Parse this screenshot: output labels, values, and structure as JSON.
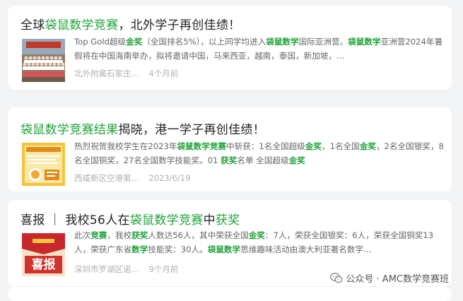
{
  "results": [
    {
      "title_parts": [
        {
          "text": "全球",
          "hl": false
        },
        {
          "text": "袋鼠数学竞赛",
          "hl": true
        },
        {
          "text": "，北外学子再创佳绩！",
          "hl": false
        }
      ],
      "snippet_parts": [
        {
          "text": "Top Gold超级",
          "hl": 0
        },
        {
          "text": "金奖",
          "hl": 2
        },
        {
          "text": "（全国排名5%），以上同学均进入",
          "hl": 0
        },
        {
          "text": "袋鼠数学",
          "hl": 2
        },
        {
          "text": "国际亚洲营。",
          "hl": 0
        },
        {
          "text": "袋鼠数学",
          "hl": 2
        },
        {
          "text": "亚洲营2024年暑假将在中国海南举办，拟将邀请中国，马来西亚，越南，泰国，新加坡，...",
          "hl": 0
        }
      ],
      "source": "北外附属石家庄...",
      "time": "4个月前",
      "thumb": "group-photo"
    },
    {
      "title_parts": [
        {
          "text": "袋鼠数学竞赛结果",
          "hl": true
        },
        {
          "text": "揭晓，港一学子再创佳绩！",
          "hl": false
        }
      ],
      "snippet_parts": [
        {
          "text": "热烈祝贺我校学生在2023年",
          "hl": 0
        },
        {
          "text": "袋鼠数学竞赛",
          "hl": 2
        },
        {
          "text": "中斩获：1名全国超级",
          "hl": 0
        },
        {
          "text": "金奖",
          "hl": 2
        },
        {
          "text": "，1名全国",
          "hl": 0
        },
        {
          "text": "金奖",
          "hl": 2
        },
        {
          "text": "，2名全国银奖，8名全国铜奖，27名全国数学技能奖。01 ",
          "hl": 0
        },
        {
          "text": "获奖",
          "hl": 2
        },
        {
          "text": "名单 全国超级",
          "hl": 0
        },
        {
          "text": "金奖",
          "hl": 2
        }
      ],
      "source": "西咸新区空港第...",
      "time": "2023/6/19",
      "thumb": "yellow-poster"
    },
    {
      "title_parts": [
        {
          "text": "喜报 ｜ 我校56人在",
          "hl": false
        },
        {
          "text": "袋鼠数学竞赛",
          "hl": true
        },
        {
          "text": "中",
          "hl": false
        },
        {
          "text": "获奖",
          "hl": true
        }
      ],
      "snippet_parts": [
        {
          "text": "此次",
          "hl": 0
        },
        {
          "text": "竞赛",
          "hl": 2
        },
        {
          "text": "，我校",
          "hl": 0
        },
        {
          "text": "获奖",
          "hl": 2
        },
        {
          "text": "人数达56人，其中荣获全国",
          "hl": 0
        },
        {
          "text": "金奖",
          "hl": 2
        },
        {
          "text": "：7人，荣获全国银奖：6人，荣获全国铜奖13人，荣获广东省",
          "hl": 0
        },
        {
          "text": "数学",
          "hl": 2
        },
        {
          "text": "技能奖：30人。",
          "hl": 0
        },
        {
          "text": "袋鼠数学",
          "hl": 2
        },
        {
          "text": "思维趣味活动由澳大利亚著名数学...",
          "hl": 0
        }
      ],
      "source": "深圳市罗湖区诺...",
      "time": "9个月前",
      "thumb": "xibao-poster",
      "thumb_text": "喜报"
    }
  ],
  "watermark": {
    "text": "公众号 · AMC数学竞赛班",
    "icon": "wechat-icon"
  },
  "colors": {
    "highlight": "#22a33b",
    "muted": "#b0b0b0",
    "snippet": "#666666",
    "background": "#f2f3f5"
  }
}
